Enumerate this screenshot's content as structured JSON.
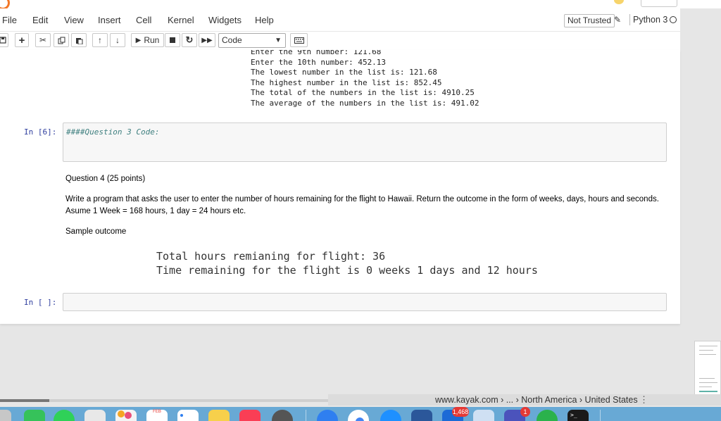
{
  "menubar": {
    "items": [
      "File",
      "Edit",
      "View",
      "Insert",
      "Cell",
      "Kernel",
      "Widgets",
      "Help"
    ],
    "trust_status": "Not Trusted",
    "kernel_name": "Python 3"
  },
  "toolbar": {
    "run_label": "Run",
    "cell_type": "Code",
    "icons": [
      "save-icon",
      "plus-icon",
      "cut-icon",
      "copy-icon",
      "paste-icon",
      "arrow-up-icon",
      "arrow-down-icon",
      "run-icon",
      "stop-icon",
      "restart-icon",
      "fast-forward-icon",
      "keyboard-icon"
    ]
  },
  "output_lines": [
    "Enter the 9th number: 121.68",
    "Enter the 10th number: 452.13",
    "The lowest number in the list is: 121.68",
    "The highest number in the list is: 852.45",
    "The total of the numbers in the list is: 4910.25",
    "The average of the numbers in the list is: 491.02"
  ],
  "cells": {
    "cell6_prompt": "In [6]:",
    "cell6_code": "####Question 3 Code:",
    "empty_prompt": "In [ ]:"
  },
  "markdown": {
    "heading": "Question 4 (25 points)",
    "paragraph": "Write a program that asks the user to enter the number of hours remaining for the flight to Hawaii. Return the outcome in the form of weeks, days, hours and seconds. Asume 1 Week = 168 hours, 1 day = 24 hours etc.",
    "sample_label": "Sample outcome",
    "sample_line1": "Total hours remianing for flight: 36",
    "sample_line2": "Time remaining for the flight is 0 weeks 1 days and 12 hours"
  },
  "browser": {
    "url_text": "www.kayak.com › ... › North America › United States"
  },
  "dock": {
    "calendar_month": "FEB",
    "mail_badge": "1,468",
    "teams_badge": "1"
  }
}
